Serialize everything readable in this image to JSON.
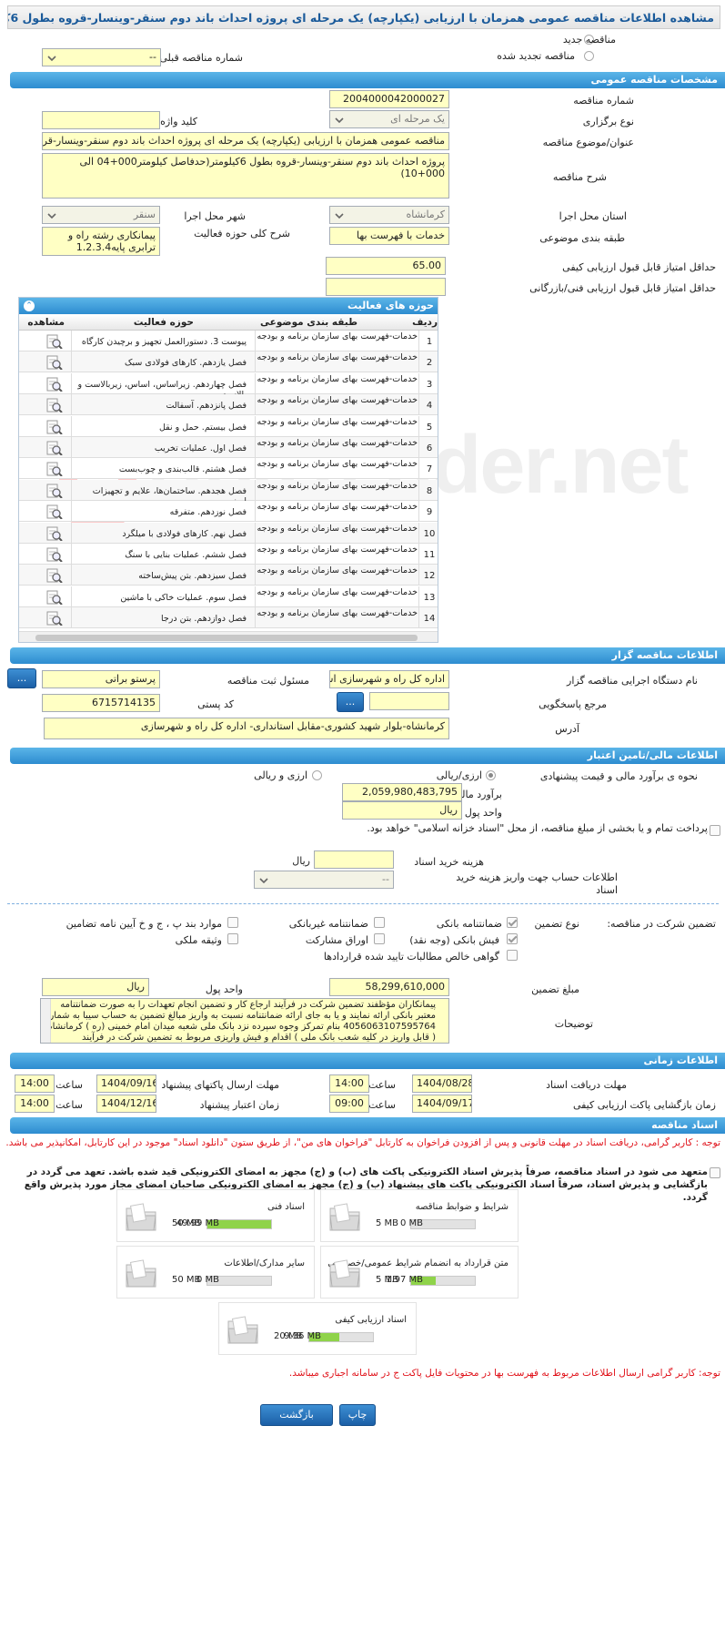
{
  "page_title": "مشاهده اطلاعات مناقصه عمومی همزمان با ارزیابی (یکپارچه) یک مرحله ای پروژه احداث باند دوم سنقر-وینسار-قروه بطول 6کیلومتر",
  "top": {
    "new_tender": "مناقصه جدید",
    "renewed_tender": "مناقصه تجدید شده",
    "prev_tender_no_label": "شماره مناقصه قبلی",
    "prev_tender_no_value": "--"
  },
  "general": {
    "header": "مشخصات مناقصه عمومی",
    "tender_no_label": "شماره مناقصه",
    "tender_no": "2004000042000027",
    "host_type_label": "نوع برگزاری",
    "host_type": "یک مرحله ای",
    "keyword_label": "کلید واژه",
    "keyword": "",
    "subject_label": "عنوان/موضوع مناقصه",
    "subject": "مناقصه عمومی همزمان با ارزیابی (یکپارچه) یک مرحله ای پروژه احداث باند دوم سنقر-وینسار-قروه",
    "desc_label": "شرح مناقصه",
    "desc": "پروژه احداث باند دوم سنقر-وینسار-قروه بطول 6کیلومتر(حدفاصل کیلومتر000+04 الی 000+10)",
    "province_label": "استان محل اجرا",
    "province": "کرمانشاه",
    "city_label": "شهر محل اجرا",
    "city": "سنقر",
    "category_label": "طبقه بندی موضوعی",
    "category": "خدمات با فهرست بها",
    "activity_desc_label": "شرح کلی حوزه فعالیت",
    "activity_desc": "پیمانکاری رشته راه و ترابری پایه1.2.3.4",
    "min_quality_label": "حداقل امتیاز قابل قبول ارزیابی کیفی",
    "min_quality": "65.00",
    "min_tech_label": "حداقل امتیاز قابل قبول ارزیابی فنی/بازرگانی",
    "min_tech": ""
  },
  "activity": {
    "header": "حوزه های فعالیت",
    "cols": [
      "ردیف",
      "طبقه بندی موضوعی",
      "حوزه فعالیت",
      "مشاهده"
    ],
    "rows": [
      {
        "i": "1",
        "cat": "خدمات-فهرست بهای سازمان برنامه و بودجه",
        "act": "پیوست 3. دستورالعمل تجهیز و برچیدن کارگاه"
      },
      {
        "i": "2",
        "cat": "خدمات-فهرست بهای سازمان برنامه و بودجه",
        "act": "فصل یازدهم. کارهای فولادی سبک"
      },
      {
        "i": "3",
        "cat": "خدمات-فهرست بهای سازمان برنامه و بودجه",
        "act": "فصل چهاردهم. زیراساس، اساس، زیربالاست و بالاست"
      },
      {
        "i": "4",
        "cat": "خدمات-فهرست بهای سازمان برنامه و بودجه",
        "act": "فصل پانزدهم. آسفالت"
      },
      {
        "i": "5",
        "cat": "خدمات-فهرست بهای سازمان برنامه و بودجه",
        "act": "فصل بیستم. حمل و نقل"
      },
      {
        "i": "6",
        "cat": "خدمات-فهرست بهای سازمان برنامه و بودجه",
        "act": "فصل اول. عملیات تخریب"
      },
      {
        "i": "7",
        "cat": "خدمات-فهرست بهای سازمان برنامه و بودجه",
        "act": "فصل هشتم. قالب‌بندی و چوب‌بست"
      },
      {
        "i": "8",
        "cat": "خدمات-فهرست بهای سازمان برنامه و بودجه",
        "act": "فصل هجدهم. ساختمان‌ها، علایم و تجهیزات ایمنی"
      },
      {
        "i": "9",
        "cat": "خدمات-فهرست بهای سازمان برنامه و بودجه",
        "act": "فصل نوزدهم. متفرقه"
      },
      {
        "i": "10",
        "cat": "خدمات-فهرست بهای سازمان برنامه و بودجه",
        "act": "فصل نهم. کارهای فولادی با میلگرد"
      },
      {
        "i": "11",
        "cat": "خدمات-فهرست بهای سازمان برنامه و بودجه",
        "act": "فصل ششم. عملیات بنایی با سنگ"
      },
      {
        "i": "12",
        "cat": "خدمات-فهرست بهای سازمان برنامه و بودجه",
        "act": "فصل سیزدهم. بتن پیش‌ساخته"
      },
      {
        "i": "13",
        "cat": "خدمات-فهرست بهای سازمان برنامه و بودجه",
        "act": "فصل سوم. عملیات خاکی با ماشین"
      },
      {
        "i": "14",
        "cat": "خدمات-فهرست بهای سازمان برنامه و بودجه",
        "act": "فصل دوازدهم. بتن درجا"
      }
    ]
  },
  "organizer": {
    "header": "اطلاعات مناقصه گزار",
    "org_label": "نام دستگاه اجرایی مناقصه گزار",
    "org": "اداره کل راه و شهرسازی استان کرمانشاه",
    "responsible_label": "مسئول ثبت مناقصه",
    "responsible": "پرستو براتی",
    "ref_label": "مرجع پاسخگویی",
    "ref": "",
    "postal_label": "کد پستی",
    "postal": "6715714135",
    "address_label": "آدرس",
    "address": "کرمانشاه-بلوار شهید کشوری-مقابل استانداری- اداره کل راه و شهرسازی",
    "more_btn": "..."
  },
  "finance": {
    "header": "اطلاعات مالی/تامین اعتبار",
    "method_label": "نحوه ی برآورد مالی و قیمت پیشنهادی",
    "opt1": "ارزی/ریالی",
    "opt2": "ارزی و ریالی",
    "estimate_label": "برآورد مالی",
    "estimate": "2,059,980,483,795",
    "currency_label": "واحد پول",
    "currency": "ریال",
    "treasury_note": "پرداخت تمام و یا بخشی از مبلغ مناقصه، از محل \"اسناد خزانه اسلامی\" خواهد بود.",
    "doc_cost_label": "هزینه خرید اسناد",
    "doc_cost_unit": "ریال",
    "account_label": "اطلاعات حساب جهت واریز هزینه خرید اسناد",
    "account": "--",
    "guarantee_label": "تضمین شرکت در مناقصه:",
    "guarantee_type_label": "نوع تضمین",
    "g": [
      "ضمانتنامه بانکی",
      "ضمانتنامه غیربانکی",
      "موارد بند پ ، ج و خ آیین نامه تضامین",
      "فیش بانکی (وجه نقد)",
      "اوراق مشارکت",
      "وثیقه ملکی",
      "گواهی خالص مطالبات تایید شده قراردادها"
    ],
    "amount_label": "مبلغ تضمین",
    "amount": "58,299,610,000",
    "amount_currency_label": "واحد پول",
    "amount_currency": "ریال",
    "notes_label": "توضیحات",
    "notes": "پیمانکاران مؤظفند تضمین شرکت در فرآیند ارجاع کار و تضمین انجام تعهدات را به صورت ضمانتنامه معتبر بانکی  ارائه نمایند و یا به جای ارائه ضمانتنامه نسبت به واریز مبالغ تضمین به حساب سیبا به شماره 4056063107595764 بنام تمرکز وجوه سپرده نزد بانک ملی شعبه میدان امام خمینی (ره ) کرمانشاه ( قابل واریز در کلیه شعب بانک ملی ) اقدام و فیش واریزی مربوط به تضمین شرکت در فرآیند"
  },
  "timing": {
    "header": "اطلاعات زمانی",
    "receive_label": "مهلت دریافت اسناد",
    "receive_date": "1404/08/28",
    "receive_time": "14:00",
    "send_label": "مهلت ارسال پاکتهای پیشنهاد",
    "send_date": "1404/09/16",
    "send_time": "14:00",
    "open_label": "زمان بازگشایی پاکت ارزیابی کیفی",
    "open_date": "1404/09/17",
    "open_time": "09:00",
    "valid_label": "زمان اعتبار پیشنهاد",
    "valid_date": "1404/12/16",
    "valid_time": "14:00",
    "time_label": "ساعت"
  },
  "docs": {
    "header": "اسناد مناقصه",
    "note1": "توجه : کاربر گرامی، دریافت اسناد در مهلت قانونی و پس از افزودن فراخوان به کارتابل \"فراخوان های من\"، از طریق ستون \"دانلود اسناد\" موجود در این کارتابل، امکانپذیر می باشد.",
    "note2": "متعهد می شود در اسناد مناقصه، صرفاً پذیرش اسناد الکترونیکی پاکت های (ب) و (ج) مجهز به امضای الکترونیکی قید شده باشد. تعهد می گردد در بازگشایی و پذیرش اسناد، صرفاً اسناد الکترونیکی پاکت های پیشنهاد (ب) و (ج) مجهز به امضای الکترونیکی صاحبان امضای مجاز مورد پذیرش واقع گردد.",
    "files": [
      {
        "title": "شرایط و ضوابط مناقصه",
        "used": "0 MB",
        "max": "5 MB",
        "pct": 0
      },
      {
        "title": "اسناد فنی",
        "used": "49.99 MB",
        "max": "50 MB",
        "pct": 1.0
      },
      {
        "title": "متن قرارداد به انضمام شرایط عمومی/خصوصی",
        "used": "1.97 MB",
        "max": "5 MB",
        "pct": 0.39
      },
      {
        "title": "سایر مدارک/اطلاعات",
        "used": "0 MB",
        "max": "50 MB",
        "pct": 0
      },
      {
        "title": "اسناد ارزیابی کیفی",
        "used": "9.36 MB",
        "max": "20 MB",
        "pct": 0.47
      }
    ],
    "note3": "توجه: کاربر گرامی ارسال اطلاعات مربوط به فهرست بها در محتویات فایل پاکت ج در سامانه اجباری میباشد."
  },
  "buttons": {
    "back": "بازگشت",
    "print": "چاپ"
  },
  "watermark": "AriaTender.net"
}
